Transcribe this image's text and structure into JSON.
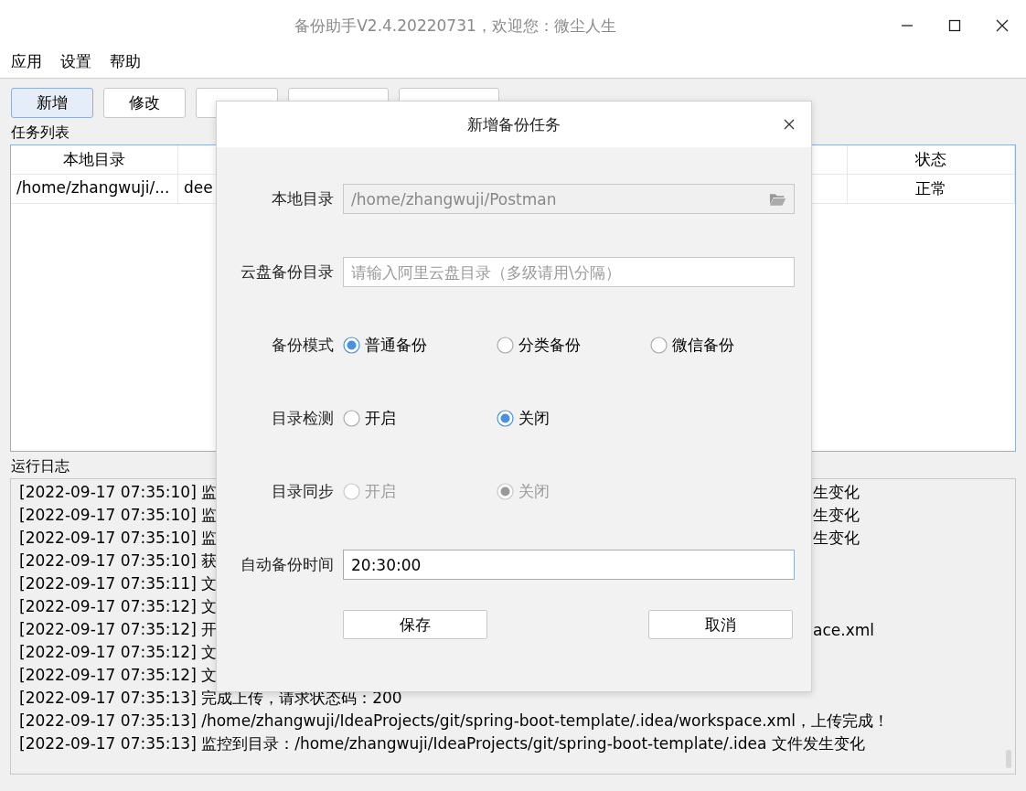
{
  "window": {
    "title": "备份助手V2.4.20220731，欢迎您：微尘人生"
  },
  "menu": [
    "应用",
    "设置",
    "帮助"
  ],
  "toolbar": [
    {
      "label": "新增",
      "selected": true
    },
    {
      "label": "修改",
      "selected": false
    },
    {
      "selected": false
    },
    {
      "selected": false
    },
    {
      "selected": false
    }
  ],
  "task_list": {
    "title": "任务列表",
    "columns": [
      {
        "label": "本地目录"
      },
      {
        "label": "状态"
      }
    ],
    "rows": [
      {
        "local_dir": "/home/zhangwuji/...",
        "column_2": "dee",
        "status": "正常"
      }
    ]
  },
  "log": {
    "title": "运行日志",
    "lines": [
      {
        "text": "[2022-09-17 07:35:10] 监",
        "tail": "生变化"
      },
      {
        "text": "[2022-09-17 07:35:10] 监",
        "tail": "生变化"
      },
      {
        "text": "[2022-09-17 07:35:10] 监",
        "tail": "生变化"
      },
      {
        "text": "[2022-09-17 07:35:10] 获"
      },
      {
        "text": "[2022-09-17 07:35:11] 文"
      },
      {
        "text": "[2022-09-17 07:35:12] 文"
      },
      {
        "text": "[2022-09-17 07:35:12] 开",
        "tail": "ace.xml"
      },
      {
        "text": "[2022-09-17 07:35:12] 文"
      },
      {
        "text": "[2022-09-17 07:35:12] 文"
      },
      {
        "text": "[2022-09-17 07:35:13] 完成上传，请求状态码：200"
      },
      {
        "text": "[2022-09-17 07:35:13] /home/zhangwuji/IdeaProjects/git/spring-boot-template/.idea/workspace.xml，上传完成！"
      },
      {
        "text": "[2022-09-17 07:35:13] 监控到目录：/home/zhangwuji/IdeaProjects/git/spring-boot-template/.idea 文件发生变化"
      }
    ]
  },
  "dialog": {
    "title": "新增备份任务",
    "fields": [
      {
        "kind": "path",
        "label": "本地目录",
        "value": "/home/zhangwuji/Postman",
        "disabled": true
      },
      {
        "kind": "text",
        "label": "云盘备份目录",
        "placeholder": "请输入阿里云盘目录（多级请用\\分隔）",
        "disabled": false
      },
      {
        "kind": "radio",
        "label": "备份模式",
        "disabled": false,
        "options": [
          {
            "label": "普通备份",
            "selected": true
          },
          {
            "label": "分类备份",
            "selected": false
          },
          {
            "label": "微信备份",
            "selected": false
          }
        ]
      },
      {
        "kind": "radio",
        "label": "目录检测",
        "disabled": false,
        "options": [
          {
            "label": "开启",
            "selected": false
          },
          {
            "label": "关闭",
            "selected": true
          }
        ]
      },
      {
        "kind": "radio",
        "label": "目录同步",
        "disabled": true,
        "options": [
          {
            "label": "开启",
            "selected": false
          },
          {
            "label": "关闭",
            "selected": true
          }
        ]
      },
      {
        "kind": "text",
        "label": "自动备份时间",
        "value": "20:30:00",
        "disabled": false,
        "focused": true
      }
    ],
    "buttons": [
      "保存",
      "取消"
    ]
  }
}
